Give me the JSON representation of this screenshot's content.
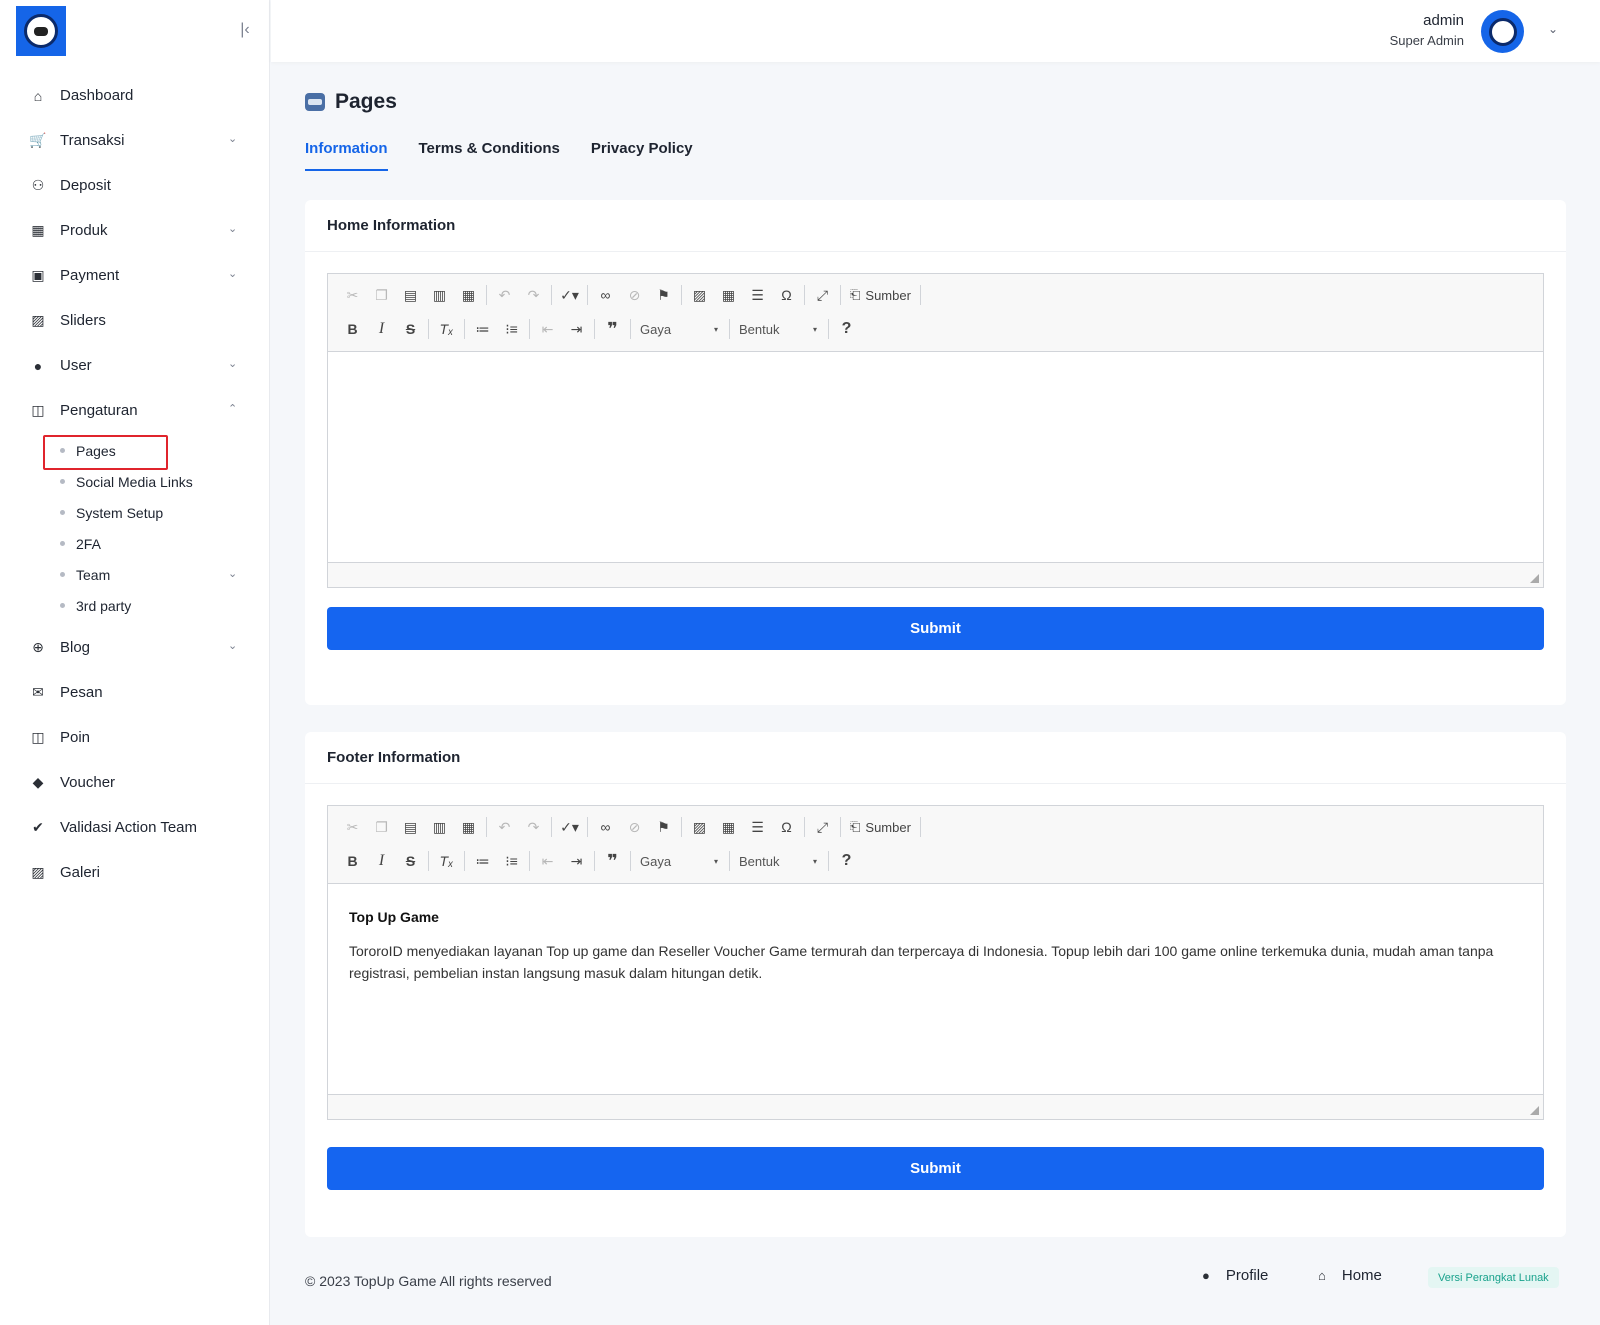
{
  "sidebar": {
    "items": [
      {
        "label": "Dashboard",
        "icon": "home-icon",
        "glyph": "⌂",
        "caret": ""
      },
      {
        "label": "Transaksi",
        "icon": "cart-icon",
        "glyph": "🛒",
        "caret": "⌄"
      },
      {
        "label": "Deposit",
        "icon": "deposit-icon",
        "glyph": "⚇",
        "caret": ""
      },
      {
        "label": "Produk",
        "icon": "store-icon",
        "glyph": "▦",
        "caret": "⌄"
      },
      {
        "label": "Payment",
        "icon": "wallet-icon",
        "glyph": "▣",
        "caret": "⌄"
      },
      {
        "label": "Sliders",
        "icon": "image-icon",
        "glyph": "▨",
        "caret": ""
      },
      {
        "label": "User",
        "icon": "user-icon",
        "glyph": "●",
        "caret": "⌄"
      },
      {
        "label": "Pengaturan",
        "icon": "settings-icon",
        "glyph": "◫",
        "caret": "⌃"
      }
    ],
    "sub_items": [
      "Pages",
      "Social Media Links",
      "System Setup",
      "2FA",
      "Team",
      "3rd party"
    ],
    "sub_team_caret": "⌄",
    "items_after": [
      {
        "label": "Blog",
        "icon": "globe-icon",
        "glyph": "⊕",
        "caret": "⌄"
      },
      {
        "label": "Pesan",
        "icon": "mail-icon",
        "glyph": "✉",
        "caret": ""
      },
      {
        "label": "Poin",
        "icon": "points-icon",
        "glyph": "◫",
        "caret": ""
      },
      {
        "label": "Voucher",
        "icon": "tag-icon",
        "glyph": "◆",
        "caret": ""
      },
      {
        "label": "Validasi Action Team",
        "icon": "check-icon",
        "glyph": "✔",
        "caret": ""
      },
      {
        "label": "Galeri",
        "icon": "gallery-icon",
        "glyph": "▨",
        "caret": ""
      }
    ],
    "collapse_glyph": "|‹"
  },
  "topbar": {
    "user_name": "admin",
    "user_role": "Super Admin",
    "caret": "⌄"
  },
  "page": {
    "title": "Pages",
    "tabs": [
      "Information",
      "Terms & Conditions",
      "Privacy Policy"
    ]
  },
  "editor_toolbar": {
    "source_label": "Sumber",
    "style_combo": "Gaya",
    "format_combo": "Bentuk",
    "combo_caret": "▾",
    "help": "?"
  },
  "home_card": {
    "title": "Home Information",
    "submit_label": "Submit"
  },
  "footer_card": {
    "title": "Footer Information",
    "content_heading": "Top Up Game",
    "content_body": "TororoID menyediakan layanan Top up game dan Reseller Voucher Game termurah dan terpercaya di Indonesia. Topup lebih dari 100 game online terkemuka dunia, mudah aman tanpa registrasi, pembelian instan langsung masuk dalam hitungan detik.",
    "submit_label": "Submit"
  },
  "footer": {
    "copyright": "© 2023 TopUp Game All rights reserved",
    "profile_label": "Profile",
    "home_label": "Home",
    "version_label": "Versi Perangkat Lunak"
  },
  "colors": {
    "primary": "#1565f0",
    "highlight_outline": "#e0242c",
    "version_badge": "#19a28c"
  }
}
